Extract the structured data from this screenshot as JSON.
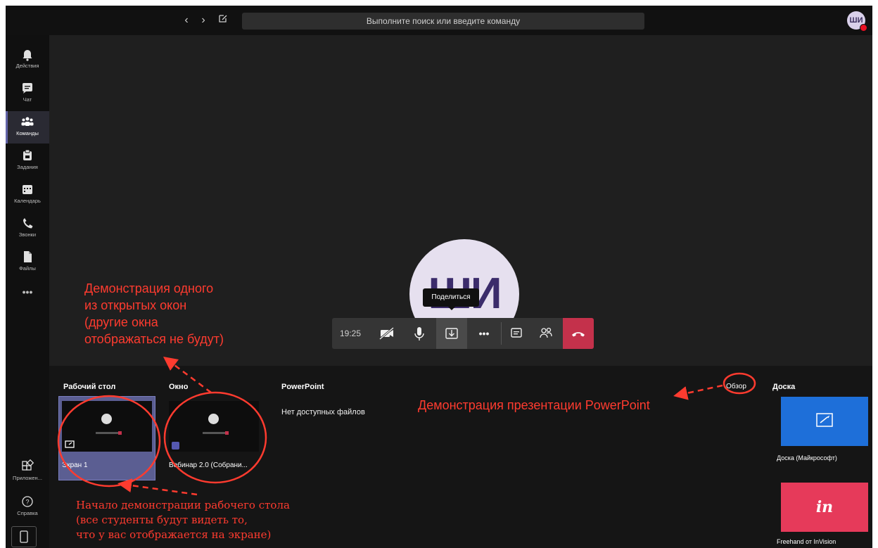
{
  "titlebar": {
    "search_placeholder": "Выполните поиск или введите команду",
    "avatar_initials": "ШИ",
    "icons": [
      "back-icon",
      "forward-icon",
      "compose-icon"
    ]
  },
  "rail": {
    "items": [
      {
        "label": "Действия",
        "icon": "bell-icon"
      },
      {
        "label": "Чат",
        "icon": "chat-icon"
      },
      {
        "label": "Команды",
        "icon": "teams-icon",
        "active": true
      },
      {
        "label": "Задания",
        "icon": "assignments-icon"
      },
      {
        "label": "Календарь",
        "icon": "calendar-icon"
      },
      {
        "label": "Звонки",
        "icon": "phone-icon"
      },
      {
        "label": "Файлы",
        "icon": "files-icon"
      }
    ],
    "more": "•••",
    "apps_label": "Приложен...",
    "help_label": "Справка"
  },
  "call": {
    "participant_initials": "ШИ",
    "timer": "19:25",
    "tooltip": "Поделиться",
    "more": "•••",
    "accent": "#6264a7",
    "hangup_color": "#c4314b"
  },
  "tray": {
    "desktop_title": "Рабочий стол",
    "window_title": "Окно",
    "powerpoint_title": "PowerPoint",
    "powerpoint_empty": "Нет доступных файлов",
    "browse": "Обзор",
    "board_title": "Доска",
    "desktop_item": "Экран 1",
    "window_item": "Вебинар 2.0 (Собрани...",
    "whiteboard_label": "Доска (Майкрософт)",
    "freehand_label": "Freehand от InVision",
    "freehand_logo": "in",
    "whiteboard_color": "#1e6fd9",
    "freehand_color": "#e63a5a"
  },
  "annotations": {
    "window_note": [
      "Демонстрация одного",
      "из открытых окон",
      "(другие окна",
      "отображаться не будут)"
    ],
    "ppt_note": "Демонстрация презентации PowerPoint",
    "desktop_note": [
      "Начало демонстрации рабочего стола",
      "(все студенты будут видеть то,",
      "что у вас отображается на экране)"
    ],
    "color": "#ff3b2f"
  }
}
